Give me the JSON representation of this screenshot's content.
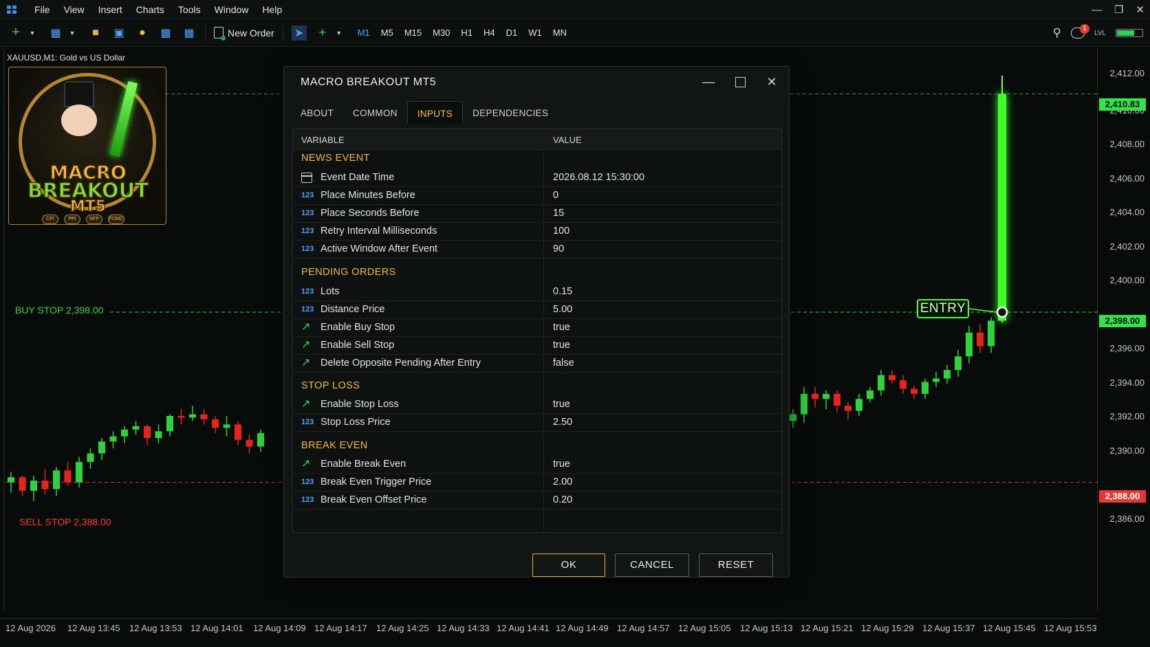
{
  "menu": [
    "File",
    "View",
    "Insert",
    "Charts",
    "Tools",
    "Window",
    "Help"
  ],
  "toolbar": {
    "new_order": "New Order",
    "timeframes": [
      "M1",
      "M5",
      "M15",
      "M30",
      "H1",
      "H4",
      "D1",
      "W1",
      "MN"
    ],
    "active_timeframe": "M1",
    "notifications": "1",
    "level_label": "LVL",
    "level_fill": 0.65
  },
  "chart": {
    "symbol": "XAUUSD,M1:  Gold vs US Dollar",
    "logo": {
      "line1": "MACRO",
      "line2": "BREAKOUT",
      "line3": "MT5",
      "tokens": [
        "CPI",
        "PPI",
        "NFP",
        "FOMC"
      ]
    },
    "buy_stop_label": "BUY STOP  2,398.00",
    "sell_stop_label": "SELL STOP  2,388.00",
    "entry_label": "ENTRY",
    "price_ticks": [
      "2,412.00",
      "2,410.00",
      "2,408.00",
      "2,406.00",
      "2,404.00",
      "2,402.00",
      "2,400.00",
      "2,396.00",
      "2,394.00",
      "2,392.00",
      "2,390.00",
      "2,386.00"
    ],
    "price_current": "2,410.83",
    "price_buy": "2,398.00",
    "price_sell": "2,388.00",
    "time_ticks": [
      "12 Aug 2026",
      "12 Aug 13:45",
      "12 Aug 13:53",
      "12 Aug 14:01",
      "12 Aug 14:09",
      "12 Aug 14:17",
      "12 Aug 14:25",
      "12 Aug 14:33",
      "12 Aug 14:41",
      "12 Aug 14:49",
      "12 Aug 14:57",
      "12 Aug 15:05",
      "12 Aug 15:13",
      "12 Aug 15:21",
      "12 Aug 15:29",
      "12 Aug 15:37",
      "12 Aug 15:45",
      "12 Aug 15:53"
    ],
    "colors": {
      "bull": "#2fd13f",
      "bear": "#e5251c",
      "buy_line": "#2fd13f",
      "sell_line": "#e5251c"
    },
    "candles_left": [
      [
        2388.0,
        2388.6,
        2387.4,
        2388.3
      ],
      [
        2388.3,
        2388.4,
        2387.2,
        2387.5
      ],
      [
        2387.5,
        2388.4,
        2386.9,
        2388.1
      ],
      [
        2388.1,
        2388.8,
        2387.3,
        2387.6
      ],
      [
        2387.6,
        2388.9,
        2387.2,
        2388.7
      ],
      [
        2388.7,
        2389.2,
        2387.8,
        2388.0
      ],
      [
        2388.0,
        2389.5,
        2387.7,
        2389.2
      ],
      [
        2389.2,
        2390.0,
        2388.8,
        2389.7
      ],
      [
        2389.7,
        2390.6,
        2389.3,
        2390.4
      ],
      [
        2390.4,
        2391.0,
        2390.0,
        2390.7
      ],
      [
        2390.7,
        2391.3,
        2390.3,
        2391.1
      ],
      [
        2391.1,
        2391.6,
        2390.8,
        2391.3
      ],
      [
        2391.3,
        2391.4,
        2390.2,
        2390.6
      ],
      [
        2390.6,
        2391.4,
        2390.3,
        2391.0
      ],
      [
        2391.0,
        2392.0,
        2390.7,
        2391.9
      ],
      [
        2391.9,
        2392.3,
        2391.4,
        2391.8
      ],
      [
        2391.8,
        2392.5,
        2391.6,
        2392.0
      ],
      [
        2392.0,
        2392.3,
        2391.4,
        2391.7
      ],
      [
        2391.7,
        2391.9,
        2390.9,
        2391.2
      ],
      [
        2391.2,
        2391.9,
        2390.7,
        2391.4
      ],
      [
        2391.4,
        2391.6,
        2390.2,
        2390.5
      ],
      [
        2390.5,
        2390.8,
        2389.7,
        2390.1
      ],
      [
        2390.1,
        2391.1,
        2389.8,
        2390.9
      ]
    ],
    "candles_right": [
      [
        2391.6,
        2392.3,
        2391.2,
        2392.0
      ],
      [
        2392.0,
        2393.6,
        2391.5,
        2393.2
      ],
      [
        2393.2,
        2393.6,
        2392.4,
        2392.9
      ],
      [
        2392.9,
        2393.4,
        2392.3,
        2393.2
      ],
      [
        2393.2,
        2393.4,
        2392.1,
        2392.5
      ],
      [
        2392.5,
        2392.7,
        2391.7,
        2392.2
      ],
      [
        2392.2,
        2393.2,
        2391.9,
        2392.9
      ],
      [
        2392.9,
        2393.6,
        2392.7,
        2393.4
      ],
      [
        2393.4,
        2394.6,
        2393.1,
        2394.3
      ],
      [
        2394.3,
        2394.6,
        2393.8,
        2394.0
      ],
      [
        2394.0,
        2394.3,
        2393.2,
        2393.5
      ],
      [
        2393.5,
        2393.7,
        2392.9,
        2393.2
      ],
      [
        2393.2,
        2394.1,
        2392.9,
        2393.9
      ],
      [
        2393.9,
        2394.5,
        2393.6,
        2394.1
      ],
      [
        2394.1,
        2394.9,
        2393.8,
        2394.6
      ],
      [
        2394.6,
        2395.8,
        2394.2,
        2395.4
      ],
      [
        2395.4,
        2397.2,
        2395.0,
        2396.8
      ],
      [
        2396.8,
        2397.3,
        2395.6,
        2396.0
      ],
      [
        2396.0,
        2397.7,
        2395.6,
        2397.5
      ],
      [
        2397.5,
        2411.9,
        2397.4,
        2410.83
      ]
    ]
  },
  "dialog": {
    "title": "MACRO BREAKOUT MT5",
    "tabs": [
      "ABOUT",
      "COMMON",
      "INPUTS",
      "DEPENDENCIES"
    ],
    "active_tab": "INPUTS",
    "headers": {
      "variable": "VARIABLE",
      "value": "VALUE"
    },
    "sections": {
      "news_event": "NEWS EVENT",
      "pending_orders": "PENDING ORDERS",
      "stop_loss": "STOP LOSS",
      "break_even": "BREAK EVEN"
    },
    "rows": [
      {
        "icon": "calendar-icon",
        "name": "Event Date Time",
        "value": "2026.08.12 15:30:00"
      },
      {
        "icon": "number-icon",
        "name": "Place Minutes Before",
        "value": "0"
      },
      {
        "icon": "number-icon",
        "name": "Place Seconds Before",
        "value": "15"
      },
      {
        "icon": "number-icon",
        "name": "Retry Interval Milliseconds",
        "value": "100"
      },
      {
        "icon": "number-icon",
        "name": "Active Window After Event",
        "value": "90"
      },
      {
        "icon": "number-icon",
        "name": "Lots",
        "value": "0.15"
      },
      {
        "icon": "number-icon",
        "name": "Distance Price",
        "value": "5.00"
      },
      {
        "icon": "bool-arrow-icon",
        "name": "Enable Buy Stop",
        "value": "true"
      },
      {
        "icon": "bool-arrow-icon",
        "name": "Enable Sell Stop",
        "value": "true"
      },
      {
        "icon": "bool-arrow-icon",
        "name": "Delete Opposite Pending After Entry",
        "value": "false"
      },
      {
        "icon": "bool-arrow-icon",
        "name": "Enable Stop Loss",
        "value": "true"
      },
      {
        "icon": "number-icon",
        "name": "Stop Loss Price",
        "value": "2.50"
      },
      {
        "icon": "bool-arrow-icon",
        "name": "Enable Break Even",
        "value": "true"
      },
      {
        "icon": "number-icon",
        "name": "Break Even Trigger Price",
        "value": "2.00"
      },
      {
        "icon": "number-icon",
        "name": "Break Even Offset Price",
        "value": "0.20"
      }
    ],
    "number_glyph": "123",
    "buttons": {
      "ok": "OK",
      "cancel": "CANCEL",
      "reset": "RESET"
    }
  }
}
